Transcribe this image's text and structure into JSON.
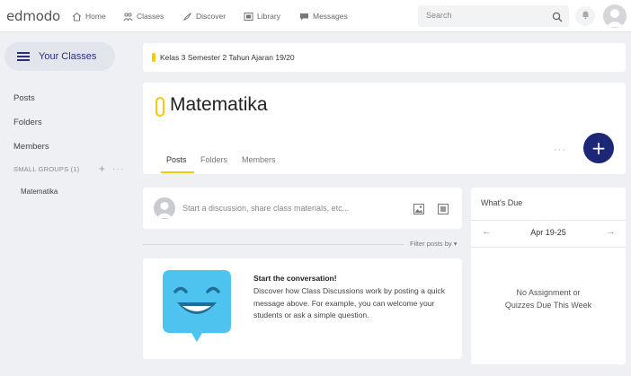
{
  "topbar": {
    "logo": "edmodo",
    "nav": [
      {
        "label": "Home",
        "icon": "home-icon"
      },
      {
        "label": "Classes",
        "icon": "classes-icon"
      },
      {
        "label": "Discover",
        "icon": "discover-icon"
      },
      {
        "label": "Library",
        "icon": "library-icon"
      },
      {
        "label": "Messages",
        "icon": "messages-icon"
      }
    ],
    "search_placeholder": "Search"
  },
  "sidebar": {
    "your_classes": "Your Classes",
    "links": [
      "Posts",
      "Folders",
      "Members"
    ],
    "small_groups": "SMALL GROUPS (1)",
    "groups": [
      "Matematika"
    ]
  },
  "announcement": "Kelas 3 Semester 2 Tahun Ajaran 19/20",
  "class": {
    "title": "Matematika",
    "tabs": [
      "Posts",
      "Folders",
      "Members"
    ],
    "active_tab": "Posts"
  },
  "composer": {
    "placeholder": "Start a discussion, share class materials, etc..."
  },
  "feed": {
    "filter_label": "Filter posts by"
  },
  "conversation": {
    "title": "Start the conversation!",
    "body": "Discover how Class Discussions work by posting a quick message above. For example, you can welcome your students or ask a simple question."
  },
  "due": {
    "title": "What's Due",
    "range": "Apr 19-25",
    "empty": "No Assignment or Quizzes Due This Week"
  },
  "colors": {
    "accent_yellow": "#f6c900",
    "brand_navy": "#1d2778",
    "illustration_blue": "#4fc3f0"
  }
}
